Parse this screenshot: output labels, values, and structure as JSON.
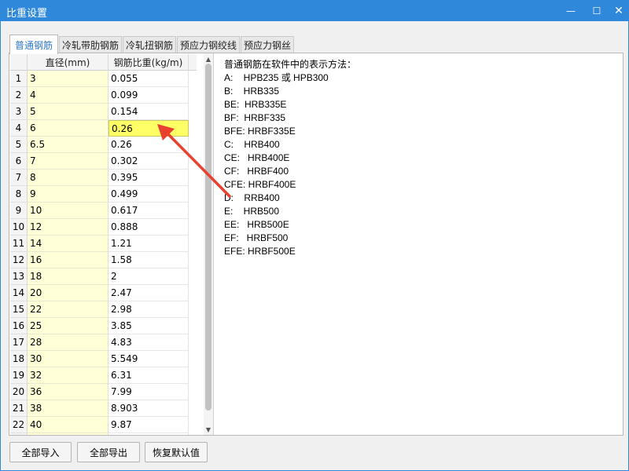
{
  "window": {
    "title": "比重设置",
    "minimize_glyph": "—",
    "maximize_glyph": "☐",
    "close_glyph": "✕"
  },
  "tabs": [
    {
      "label": "普通钢筋",
      "active": true
    },
    {
      "label": "冷轧带肋钢筋",
      "active": false
    },
    {
      "label": "冷轧扭钢筋",
      "active": false
    },
    {
      "label": "预应力钢绞线",
      "active": false
    },
    {
      "label": "预应力钢丝",
      "active": false
    }
  ],
  "table": {
    "headers": [
      "直径(mm)",
      "钢筋比重(kg/m)"
    ],
    "rows": [
      {
        "n": "1",
        "d": "3",
        "w": "0.055"
      },
      {
        "n": "2",
        "d": "4",
        "w": "0.099"
      },
      {
        "n": "3",
        "d": "5",
        "w": "0.154"
      },
      {
        "n": "4",
        "d": "6",
        "w": "0.26",
        "selected": true
      },
      {
        "n": "5",
        "d": "6.5",
        "w": "0.26"
      },
      {
        "n": "6",
        "d": "7",
        "w": "0.302"
      },
      {
        "n": "7",
        "d": "8",
        "w": "0.395"
      },
      {
        "n": "8",
        "d": "9",
        "w": "0.499"
      },
      {
        "n": "9",
        "d": "10",
        "w": "0.617"
      },
      {
        "n": "10",
        "d": "12",
        "w": "0.888"
      },
      {
        "n": "11",
        "d": "14",
        "w": "1.21"
      },
      {
        "n": "12",
        "d": "16",
        "w": "1.58"
      },
      {
        "n": "13",
        "d": "18",
        "w": "2"
      },
      {
        "n": "14",
        "d": "20",
        "w": "2.47"
      },
      {
        "n": "15",
        "d": "22",
        "w": "2.98"
      },
      {
        "n": "16",
        "d": "25",
        "w": "3.85"
      },
      {
        "n": "17",
        "d": "28",
        "w": "4.83"
      },
      {
        "n": "18",
        "d": "30",
        "w": "5.549"
      },
      {
        "n": "19",
        "d": "32",
        "w": "6.31"
      },
      {
        "n": "20",
        "d": "36",
        "w": "7.99"
      },
      {
        "n": "21",
        "d": "38",
        "w": "8.903"
      },
      {
        "n": "22",
        "d": "40",
        "w": "9.87"
      },
      {
        "n": "",
        "d": "",
        "w": ""
      }
    ]
  },
  "scrollbar": {
    "up_glyph": "▲",
    "down_glyph": "▼"
  },
  "info": {
    "lines": [
      "普通钢筋在软件中的表示方法：",
      "A:    HPB235 或 HPB300",
      "B:    HRB335",
      "BE:  HRB335E",
      "BF:  HRBF335",
      "BFE: HRBF335E",
      "C:    HRB400",
      "CE:   HRB400E",
      "CF:   HRBF400",
      "CFE: HRBF400E",
      "D:    RRB400",
      "E:    HRB500",
      "EE:   HRB500E",
      "EF:   HRBF500",
      "EFE: HRBF500E"
    ]
  },
  "buttons": {
    "import_all": "全部导入",
    "export_all": "全部导出",
    "restore_defaults": "恢复默认值"
  },
  "colors": {
    "titlebar": "#2f88d9",
    "diameter_cell": "#ffffd8",
    "selected_cell": "#ffff66",
    "annotation_arrow": "#e8412f",
    "active_tab_text": "#2f79c8"
  }
}
